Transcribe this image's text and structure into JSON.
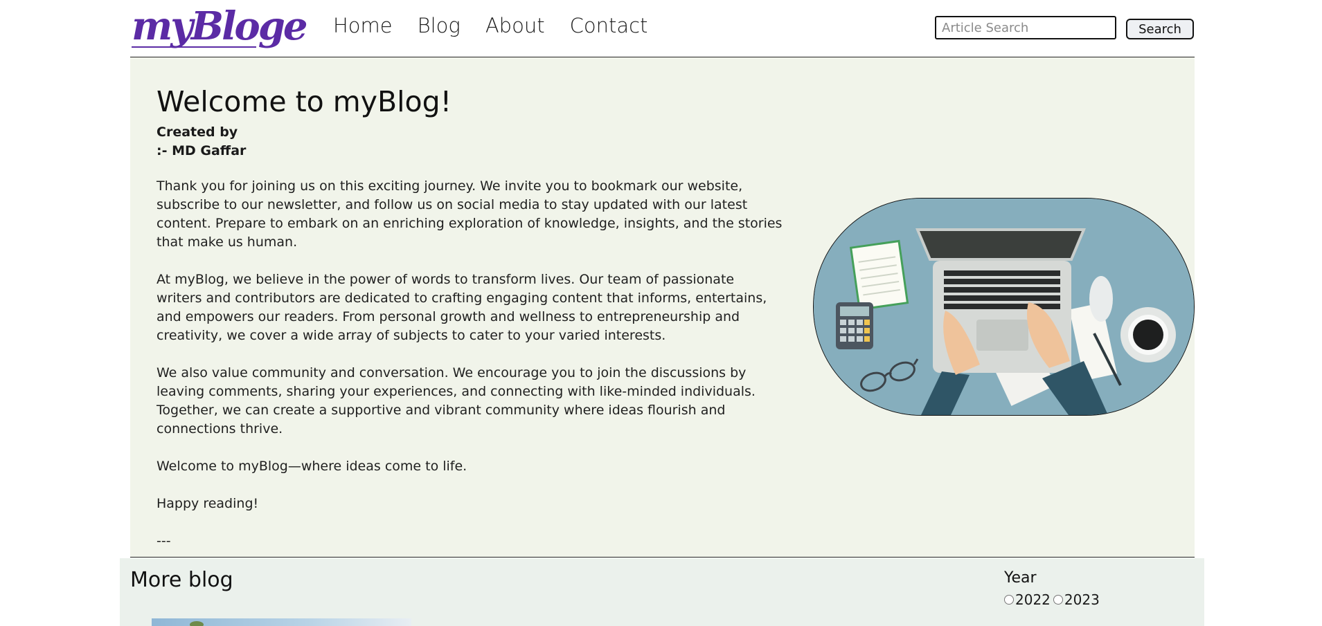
{
  "header": {
    "logo_text": "myBloge",
    "brand_color": "#5b2ba5",
    "nav": [
      "Home",
      "Blog",
      "About",
      "Contact"
    ],
    "search_placeholder": "Article Search",
    "search_button": "Search"
  },
  "welcome": {
    "title": "Welcome to myBlog!",
    "created_by": "Created by",
    "author": ":- MD Gaffar",
    "paragraphs": [
      "Thank you for joining us on this exciting journey. We invite you to bookmark our website, subscribe to our newsletter, and follow us on social media to stay updated with our latest content. Prepare to embark on an enriching exploration of knowledge, insights, and the stories that make us human.",
      "At myBlog, we believe in the power of words to transform lives. Our team of passionate writers and contributors are dedicated to crafting engaging content that informs, entertains, and empowers our readers. From personal growth and wellness to entrepreneurship and creativity, we cover a wide array of subjects to cater to your varied interests.",
      "We also value community and conversation. We encourage you to join the discussions by leaving comments, sharing your experiences, and connecting with like-minded individuals. Together, we can create a supportive and vibrant community where ideas flourish and connections thrive.",
      "Welcome to myBlog—where ideas come to life.",
      "Happy reading!",
      "---"
    ],
    "background_color": "#f1f4ea"
  },
  "more_blog": {
    "title": "More blog",
    "year_label": "Year",
    "years": [
      "2022",
      "2023"
    ],
    "background_color": "#ebf1ec"
  }
}
